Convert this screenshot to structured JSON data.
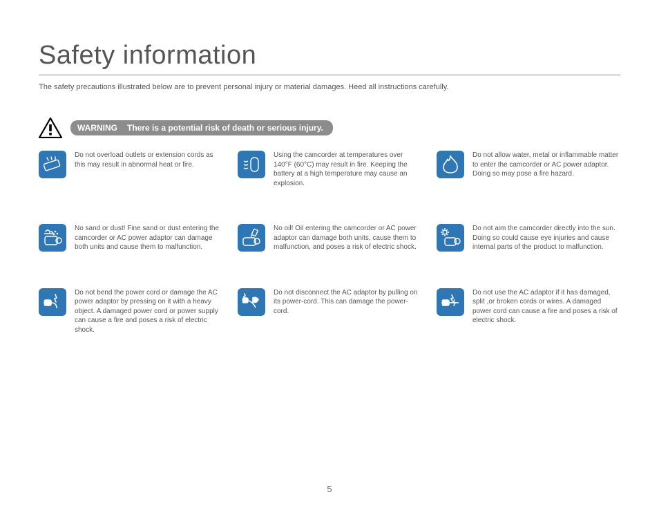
{
  "title": "Safety information",
  "intro": "The safety precautions illustrated below are to prevent personal injury or material damages. Heed all instructions carefully.",
  "warning": {
    "label": "WARNING",
    "text": "There is a potential risk of death or serious injury."
  },
  "items": [
    {
      "icon": "overload-outlet-icon",
      "text": "Do not overload outlets or extension cords as this may result in abnormal heat or fire."
    },
    {
      "icon": "high-temperature-icon",
      "text": "Using the camcorder at temperatures over 140°F (60°C) may result in fire. Keeping the battery at a high temperature may cause an explosion."
    },
    {
      "icon": "fire-hazard-icon",
      "text": "Do not allow water, metal or inflammable matter to enter the camcorder or AC power adaptor. Doing so may pose a fire hazard."
    },
    {
      "icon": "no-sand-dust-icon",
      "text": "No sand or dust! Fine sand or dust entering the camcorder or AC power adaptor can damage both units and cause them to malfunction."
    },
    {
      "icon": "no-oil-icon",
      "text": "No oil! Oil entering the camcorder or AC power adaptor can damage both units, cause them to malfunction, and poses a risk of electric shock."
    },
    {
      "icon": "no-direct-sun-icon",
      "text": "Do not aim the camcorder directly into the sun. Doing so could cause eye injuries and cause internal parts of the product to malfunction."
    },
    {
      "icon": "bent-cord-icon",
      "text": "Do not bend the power cord or damage the AC power adaptor by pressing on it with a heavy object. A damaged power cord or power supply can cause a fire and poses a risk of electric shock."
    },
    {
      "icon": "pull-cord-icon",
      "text": "Do not disconnect the AC adaptor by pulling on its power-cord. This can damage the power-cord."
    },
    {
      "icon": "damaged-cord-icon",
      "text": "Do not use the AC adaptor if it has damaged, split ,or broken cords or wires. A damaged power cord can cause a fire and poses a risk of electric shock."
    }
  ],
  "page_number": "5"
}
